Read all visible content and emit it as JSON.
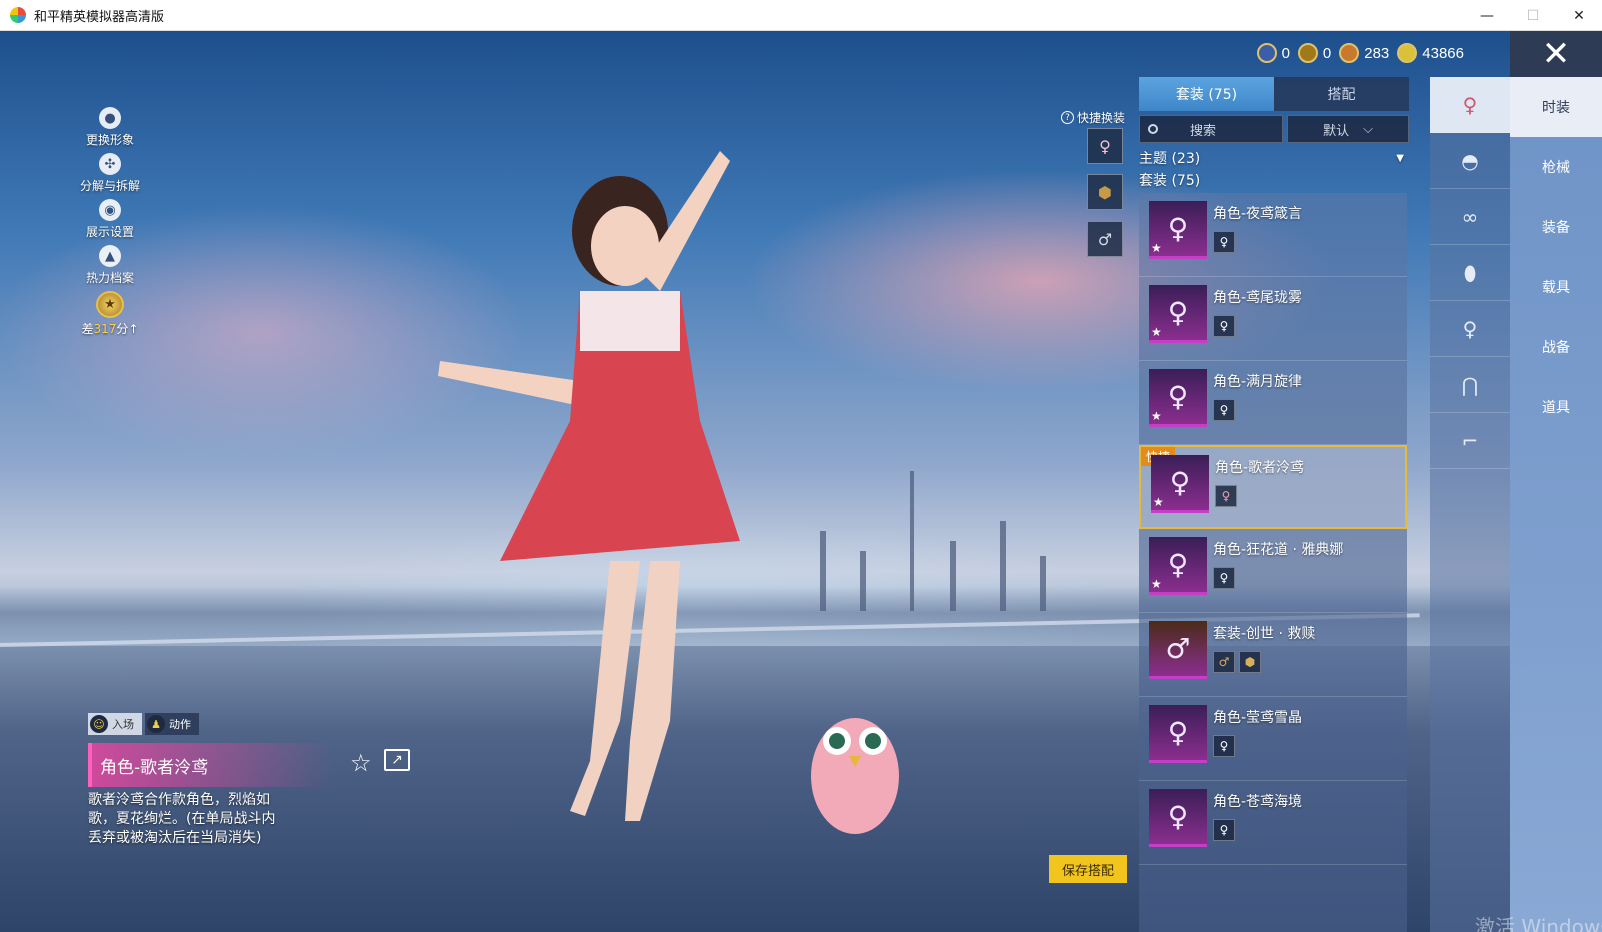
{
  "window": {
    "title": "和平精英模拟器高清版",
    "controls": [
      "—",
      "☐",
      "✕"
    ]
  },
  "left_menu": [
    {
      "label": "更换形象",
      "icon": "person-icon"
    },
    {
      "label": "分解与拆解",
      "icon": "puzzle-icon"
    },
    {
      "label": "展示设置",
      "icon": "eye-icon"
    },
    {
      "label": "热力档案",
      "icon": "flame-icon"
    }
  ],
  "rank": {
    "prefix": "差",
    "value": "317",
    "suffix": "分",
    "arrow": "↑"
  },
  "currency": [
    {
      "value": "0",
      "color": "#3b5ea8"
    },
    {
      "value": "0",
      "color": "#a07a18"
    },
    {
      "value": "283",
      "color": "#c77a2e"
    },
    {
      "value": "43866",
      "color": "#d9c23a"
    }
  ],
  "close_glyph": "✕",
  "quick_swap": {
    "label": "快捷换装",
    "help": "?"
  },
  "panel": {
    "tabs": [
      {
        "label": "套装 (75)"
      },
      {
        "label": "搭配"
      }
    ],
    "search_label": "搜索",
    "sort_label": "默认",
    "theme_row": "主题 (23)",
    "outfit_row": "套装 (75)",
    "items": [
      {
        "name": "角色-夜鸢箴言",
        "subs": 1
      },
      {
        "name": "角色-鸢尾珑雾",
        "subs": 1
      },
      {
        "name": "角色-满月旋律",
        "subs": 1
      },
      {
        "name": "角色-歌者泠鸢",
        "subs": 1,
        "quick": "快捷"
      },
      {
        "name": "角色-狂花道 · 雅典娜",
        "subs": 1
      },
      {
        "name": "套装-创世 · 救赎",
        "subs": 2
      },
      {
        "name": "角色-莹鸢雪晶",
        "subs": 1
      },
      {
        "name": "角色-苍鸢海境",
        "subs": 1
      }
    ]
  },
  "categories": [
    {
      "icon": "outfit-icon"
    },
    {
      "icon": "hat-icon"
    },
    {
      "icon": "glasses-icon"
    },
    {
      "icon": "mask-icon"
    },
    {
      "icon": "top-icon"
    },
    {
      "icon": "pants-icon"
    },
    {
      "icon": "shoes-icon"
    }
  ],
  "right_tabs": [
    "时装",
    "枪械",
    "装备",
    "载具",
    "战备",
    "道具"
  ],
  "modes": [
    {
      "label": "入场"
    },
    {
      "label": "动作"
    }
  ],
  "selected": {
    "name": "角色-歌者泠鸢",
    "description": "歌者泠鸢合作款角色，烈焰如歌，夏花绚烂。(在单局战斗内丢弃或被淘汰后在当局消失)"
  },
  "save_label": "保存搭配",
  "watermark": "激活 Windows"
}
